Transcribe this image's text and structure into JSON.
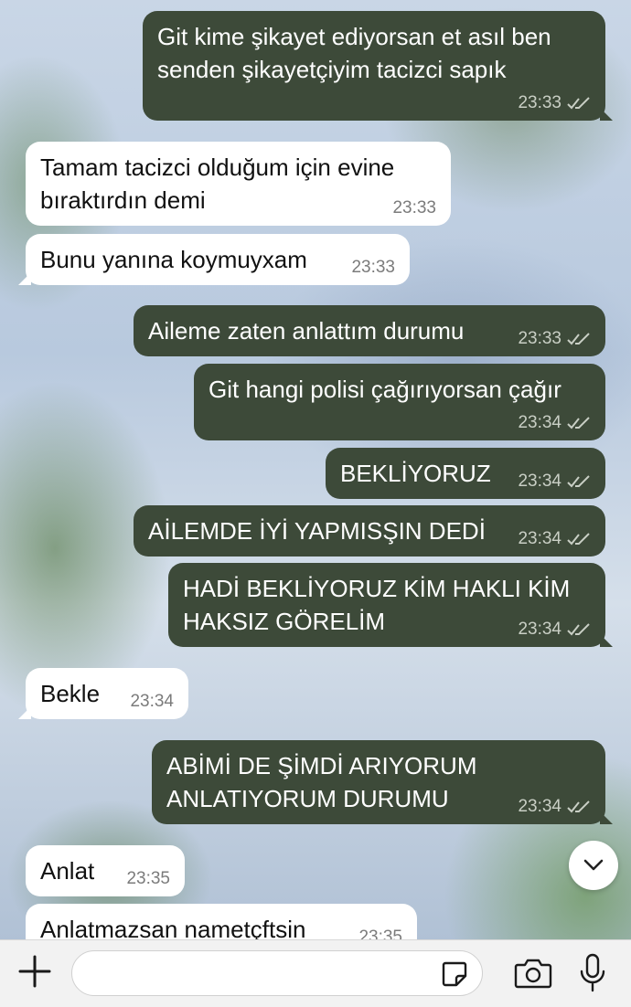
{
  "messages": [
    {
      "dir": "out",
      "text": "Git kime şikayet ediyorsan et asıl ben senden şikayetçiyim tacizci sapık",
      "time": "23:33",
      "read": true
    },
    {
      "dir": "in",
      "text": "Tamam tacizci olduğum için evine bıraktırdın demi",
      "time": "23:33"
    },
    {
      "dir": "in",
      "text": "Bunu yanına koymuyxam",
      "time": "23:33"
    },
    {
      "dir": "out",
      "text": "Aileme zaten anlattım durumu",
      "time": "23:33",
      "read": true
    },
    {
      "dir": "out",
      "text": "Git hangi polisi çağırıyorsan çağır",
      "time": "23:34",
      "read": true
    },
    {
      "dir": "out",
      "text": "BEKLİYORUZ",
      "time": "23:34",
      "read": true
    },
    {
      "dir": "out",
      "text": "AİLEMDE İYİ YAPMISŞIN DEDİ",
      "time": "23:34",
      "read": true
    },
    {
      "dir": "out",
      "text": "HADİ BEKLİYORUZ KİM HAKLI KİM HAKSIZ GÖRELİM",
      "time": "23:34",
      "read": true
    },
    {
      "dir": "in",
      "text": "Bekle",
      "time": "23:34"
    },
    {
      "dir": "out",
      "text": "ABİMİ DE ŞİMDİ ARIYORUM ANLATIYORUM DURUMU",
      "time": "23:34",
      "read": true
    },
    {
      "dir": "in",
      "text": "Anlat",
      "time": "23:35"
    },
    {
      "dir": "in",
      "text": "Anlatmazsan nametçftsin",
      "time": "23:35"
    }
  ],
  "composer": {
    "placeholder": ""
  },
  "icons": {
    "read_receipt": "double-check-icon",
    "scroll": "chevron-down-icon",
    "attach": "plus-icon",
    "sticker": "sticker-icon",
    "camera": "camera-icon",
    "mic": "microphone-icon"
  },
  "colors": {
    "outgoing_bubble": "#3d4a39",
    "incoming_bubble": "#ffffff",
    "outgoing_time": "#c9cfc5",
    "incoming_time": "#7b7b7b"
  }
}
